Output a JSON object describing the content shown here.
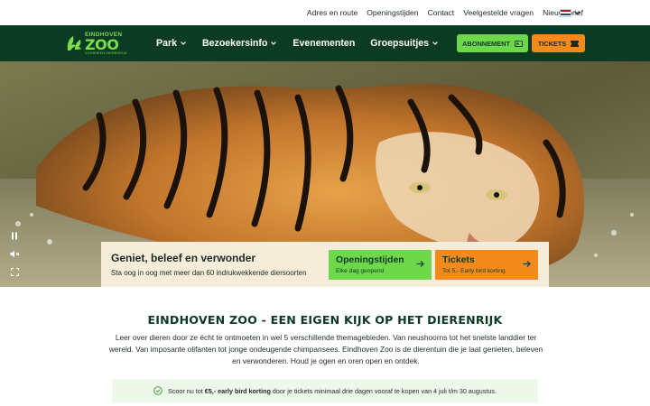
{
  "utility_nav": {
    "links": [
      "Adres en route",
      "Openingstijden",
      "Contact",
      "Veelgestelde vragen",
      "Nieuwsbrief"
    ]
  },
  "logo": {
    "line1": "EINDHOVEN",
    "line2": "ZOO",
    "line3": "VOORHEEN DIERENRIJK"
  },
  "main_nav": {
    "items": [
      {
        "label": "Park",
        "dropdown": true
      },
      {
        "label": "Bezoekersinfo",
        "dropdown": true
      },
      {
        "label": "Evenementen",
        "dropdown": false
      },
      {
        "label": "Groepsuitjes",
        "dropdown": true
      }
    ]
  },
  "header_buttons": {
    "subscription": "ABONNEMENT",
    "tickets": "TICKETS"
  },
  "hero": {
    "card_title": "Geniet, beleef en verwonder",
    "card_subtitle": "Sta oog in oog met meer dan 60 indrukwekkende diersoorten",
    "hours_button": {
      "title": "Openingstijden",
      "subtitle": "Elke dag geopend"
    },
    "tickets_button": {
      "title": "Tickets",
      "subtitle": "Tot 5,- Early bird korting"
    },
    "controls": [
      "pause-icon",
      "mute-icon",
      "fullscreen-icon"
    ]
  },
  "content": {
    "headline": "EINDHOVEN ZOO - EEN EIGEN KIJK OP HET DIERENRIJK",
    "intro": "Leer over dieren door ze écht te ontmoeten in wel 5 verschillende themagebieden. Van neushoorns tot het snelste landdier ter wereld. Van imposante olifanten tot jonge ondeugende chimpansees. Eindhoven Zoo is de dierentuin die je laat genieten, beleven en verwonderen. Houd je ogen en oren open en ontdek.",
    "promo_pre": "Scoor nu tot ",
    "promo_bold": "€5,- early bird korting",
    "promo_post": " door je tickets minimaal drie dagen vooraf te kopen van 4 juli t/m 30 augustus."
  },
  "colors": {
    "header_green": "#0b3b22",
    "accent_green": "#6fd84a",
    "accent_orange": "#f48a1b",
    "card_beige": "#f5ecd9",
    "promo_bg": "#edf7ea"
  }
}
